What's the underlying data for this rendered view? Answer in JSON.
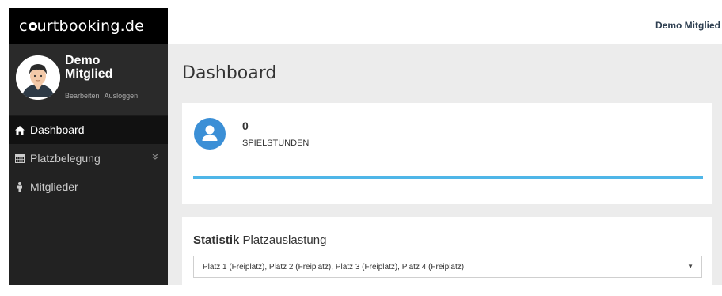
{
  "brand": {
    "prefix": "c",
    "suffix": "urtbooking.de"
  },
  "user": {
    "name_line1": "Demo",
    "name_line2": "Mitglied",
    "edit_label": "Bearbeiten",
    "logout_label": "Ausloggen"
  },
  "sidebar": {
    "items": [
      {
        "label": "Dashboard",
        "icon": "home-icon",
        "active": true
      },
      {
        "label": "Platzbelegung",
        "icon": "calendar-icon",
        "active": false,
        "expandable": true
      },
      {
        "label": "Mitglieder",
        "icon": "person-icon",
        "active": false
      }
    ]
  },
  "topbar": {
    "user_label": "Demo Mitglied"
  },
  "page": {
    "title": "Dashboard"
  },
  "stat": {
    "value": "0",
    "label": "SPIELSTUNDEN",
    "icon": "user-icon",
    "progress_fraction": 1.0
  },
  "statistik": {
    "title_bold": "Statistik",
    "title_rest": " Platzauslastung",
    "select_value": "Platz 1 (Freiplatz), Platz 2 (Freiplatz), Platz 3 (Freiplatz), Platz 4 (Freiplatz)"
  },
  "colors": {
    "sidebar_bg": "#222222",
    "brand_bg": "#000000",
    "accent_blue": "#3b8fd6",
    "progress": "#4fb6e8",
    "content_bg": "#ececec"
  }
}
